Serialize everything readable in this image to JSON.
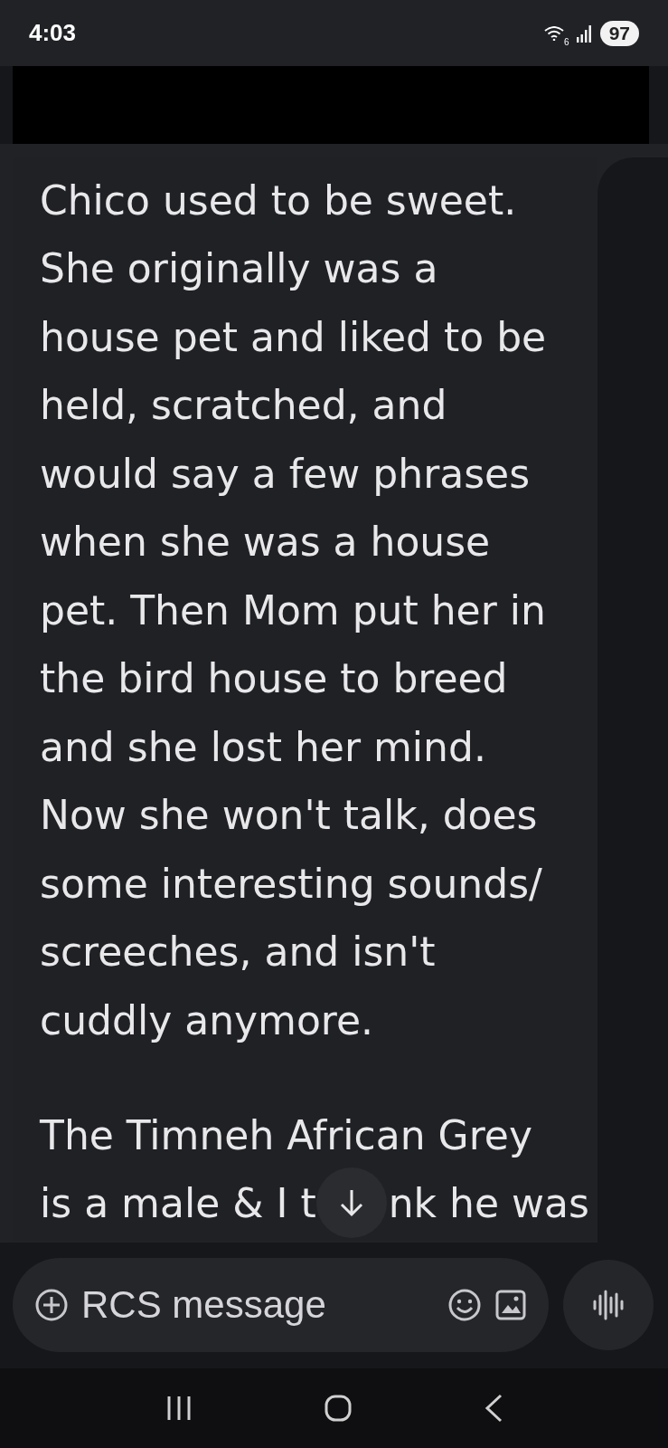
{
  "status_bar": {
    "time": "4:03",
    "wifi_label": "6",
    "battery": "97"
  },
  "message": {
    "paragraphs": [
      {
        "lines": [
          "Chico used to be sweet.",
          "She originally was a",
          "house pet and liked to be",
          "held, scratched, and",
          "would say a few phrases",
          "when she was a house",
          "pet. Then Mom put her in",
          "the bird house to breed",
          "and she lost her mind.",
          "Now she won't talk, does",
          "some interesting sounds/",
          "screeches, and isn't",
          "cuddly anymore."
        ]
      },
      {
        "lines": [
          "The Timneh African Grey",
          {
            "parts": [
              "is a male & I t",
              "nk he was"
            ]
          }
        ]
      }
    ]
  },
  "composer": {
    "placeholder": "RCS message"
  }
}
